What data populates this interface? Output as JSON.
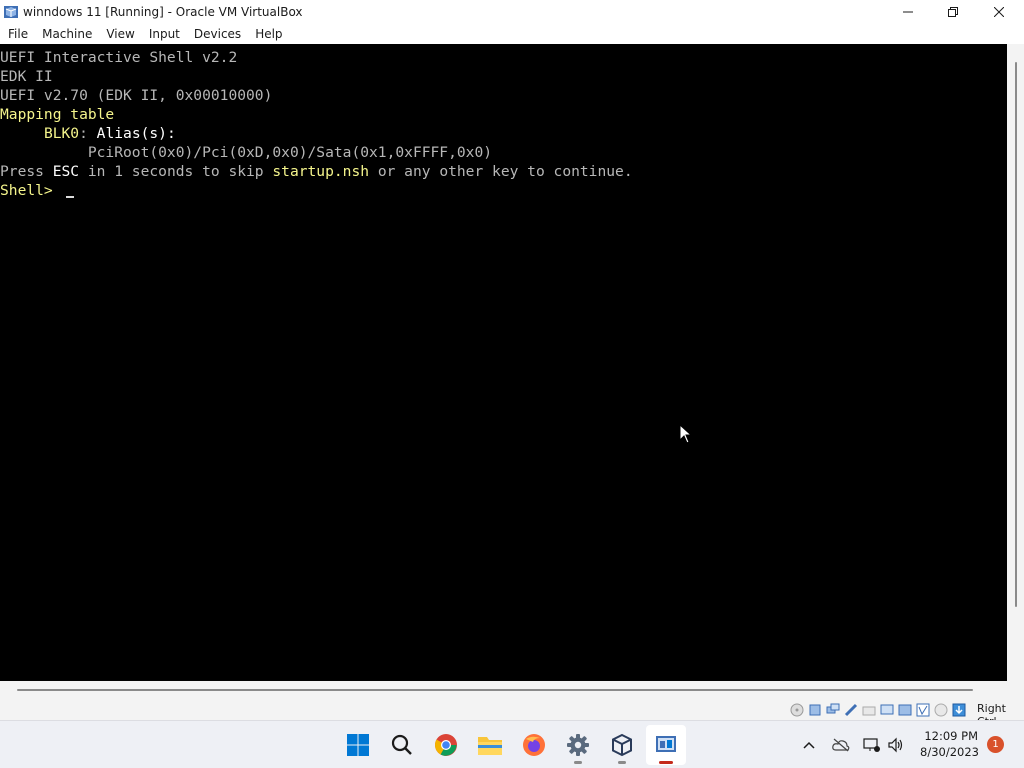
{
  "window": {
    "title": "winndows 11 [Running] - Oracle VM VirtualBox"
  },
  "menu": {
    "items": [
      "File",
      "Machine",
      "View",
      "Input",
      "Devices",
      "Help"
    ]
  },
  "terminal": {
    "line1": "UEFI Interactive Shell v2.2",
    "line2": "EDK II",
    "line3": "UEFI v2.70 (EDK II, 0x00010000)",
    "line4": "Mapping table",
    "line5_indent": "     ",
    "line5_key": "BLK0",
    "line5_colon": ":",
    "line5_rest": " Alias(s):",
    "line6": "          PciRoot(0x0)/Pci(0xD,0x0)/Sata(0x1,0xFFFF,0x0)",
    "line7_a": "Press ",
    "line7_esc": "ESC",
    "line7_b": " in 1 seconds to skip ",
    "line7_file": "startup.nsh",
    "line7_c": " or any other key to continue.",
    "prompt": "Shell> "
  },
  "statusbar": {
    "host_key": "Right Ctrl"
  },
  "taskbar": {
    "time": "12:09 PM",
    "date": "8/30/2023",
    "notification_count": "1"
  },
  "colors": {
    "yellow_text": "#f5f58c",
    "grey_text": "#b7b7b7",
    "white_text": "#ffffff",
    "windows_blue": "#0078d4",
    "badge": "#d9512b"
  }
}
